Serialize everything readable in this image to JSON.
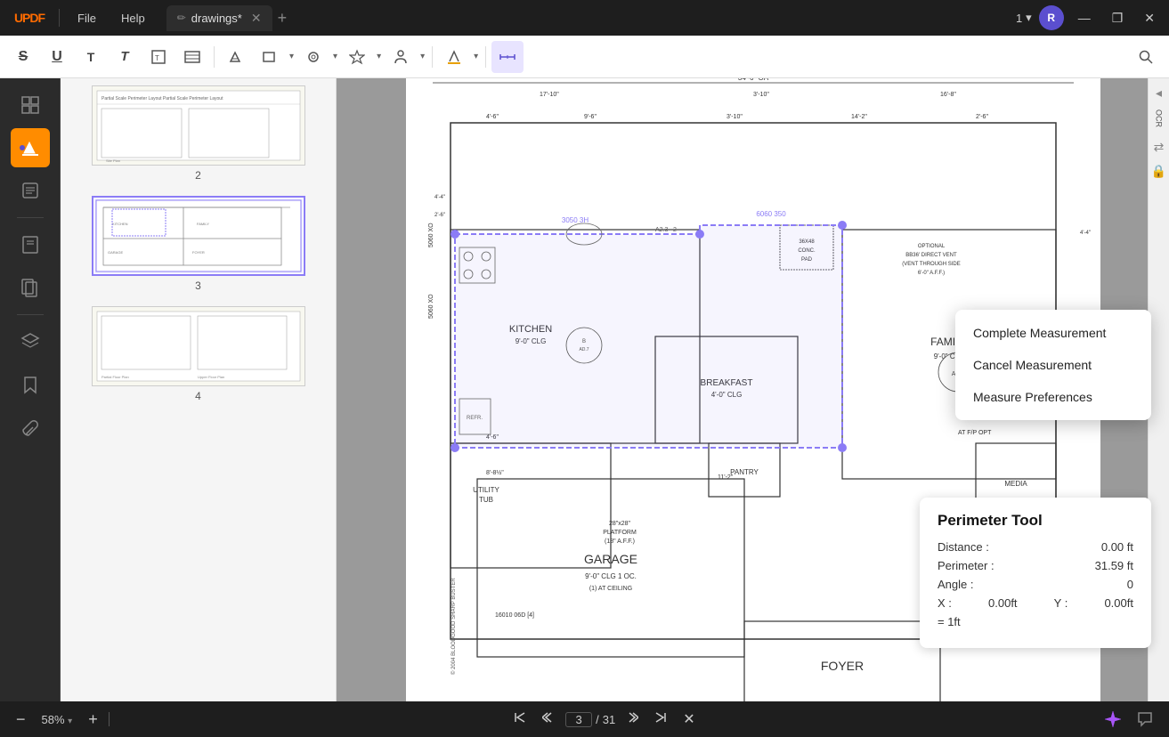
{
  "app": {
    "logo": "UPDF",
    "tab_name": "drawings*",
    "tab_icon": "✏",
    "file_menu": "File",
    "help_menu": "Help"
  },
  "title_bar": {
    "page_nav": "1",
    "page_nav_arrow": "▾",
    "user_initial": "R",
    "minimize": "—",
    "maximize": "❐",
    "close": "✕"
  },
  "toolbar": {
    "buttons": [
      {
        "name": "strikethrough",
        "icon": "S̶",
        "active": false
      },
      {
        "name": "underline",
        "icon": "U̲",
        "active": false
      },
      {
        "name": "text-t",
        "icon": "T",
        "active": false
      },
      {
        "name": "text-bold",
        "icon": "𝐓",
        "active": false
      },
      {
        "name": "text-box",
        "icon": "⊡",
        "active": false
      },
      {
        "name": "text-edit",
        "icon": "▤",
        "active": false
      },
      {
        "name": "highlight",
        "icon": "🖊",
        "active": false
      },
      {
        "name": "shapes",
        "icon": "▬",
        "active": false
      },
      {
        "name": "shapes-arrow",
        "icon": "▾",
        "active": false
      },
      {
        "name": "stamp",
        "icon": "◎",
        "active": false
      },
      {
        "name": "stamp-arrow",
        "icon": "▾",
        "active": false
      },
      {
        "name": "sticker",
        "icon": "✦",
        "active": false
      },
      {
        "name": "sticker-arrow",
        "icon": "▾",
        "active": false
      },
      {
        "name": "person",
        "icon": "👤",
        "active": false
      },
      {
        "name": "person-arrow",
        "icon": "▾",
        "active": false
      },
      {
        "name": "color-fill",
        "icon": "🖊",
        "active": false
      },
      {
        "name": "color-arrow",
        "icon": "▾",
        "active": false
      },
      {
        "name": "measure",
        "icon": "⟨/⟩",
        "active": true
      }
    ],
    "search_icon": "🔍"
  },
  "sidebar": {
    "items": [
      {
        "name": "thumbnails",
        "icon": "⊟",
        "active": false
      },
      {
        "name": "highlight-tool",
        "icon": "✏",
        "active": true
      },
      {
        "name": "notes",
        "icon": "≡",
        "active": false
      },
      {
        "name": "bookmarks",
        "icon": "⊠",
        "active": false
      },
      {
        "name": "pages",
        "icon": "⊡",
        "active": false
      },
      {
        "name": "layers",
        "icon": "⧉",
        "active": false
      },
      {
        "name": "bookmark",
        "icon": "🔖",
        "active": false
      },
      {
        "name": "attachment",
        "icon": "📎",
        "active": false
      }
    ]
  },
  "right_sidebar": {
    "ocr_label": "OCR",
    "convert_label": "Conv",
    "protect_label": "Prot"
  },
  "thumbnails": [
    {
      "page": "2",
      "selected": false
    },
    {
      "page": "3",
      "selected": true
    },
    {
      "page": "4",
      "selected": false
    }
  ],
  "context_menu": {
    "item1": "Complete Measurement",
    "item2": "Cancel Measurement",
    "item3": "Measure Preferences"
  },
  "perim_panel": {
    "title": "Perimeter Tool",
    "distance_label": "Distance :",
    "distance_value": "0.00 ft",
    "perimeter_label": "Perimeter :",
    "perimeter_value": "31.59 ft",
    "angle_label": "Angle :",
    "angle_value": "0",
    "x_label": "X :",
    "x_value": "0.00ft",
    "y_label": "Y :",
    "y_value": "0.00ft",
    "scale_label": "= 1ft"
  },
  "bottom_bar": {
    "zoom_out": "−",
    "zoom_value": "58%",
    "zoom_in": "+",
    "nav_first": "⇤",
    "nav_prev": "↑",
    "page_current": "3",
    "page_separator": "/",
    "page_total": "31",
    "nav_next": "↓",
    "nav_last": "⇥",
    "close_bar": "✕"
  }
}
